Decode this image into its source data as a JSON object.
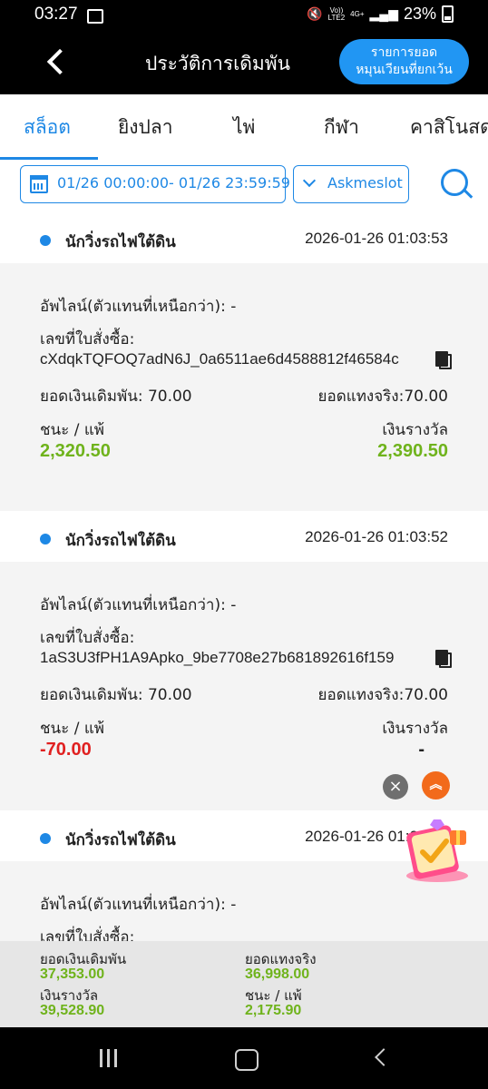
{
  "status_bar": {
    "time": "03:27",
    "network_top": "Vo))",
    "network_bottom": "LTE2",
    "data_top": "4G+",
    "battery": "23%"
  },
  "header": {
    "title": "ประวัติการเดิมพัน",
    "turnover_line1": "รายการยอด",
    "turnover_line2": "หมุนเวียนที่ยกเว้น"
  },
  "tabs": [
    {
      "label": "สล็อต",
      "active": true
    },
    {
      "label": "ยิงปลา",
      "active": false
    },
    {
      "label": "ไพ่",
      "active": false
    },
    {
      "label": "กีฬา",
      "active": false
    },
    {
      "label": "คาสิโนสด",
      "active": false
    }
  ],
  "filter": {
    "date_range": "01/26 00:00:00- 01/26 23:59:59",
    "game": "Askmeslot"
  },
  "records": [
    {
      "game": "นักวิ่งรถไฟใต้ดิน",
      "time": "2026-01-26 01:03:53",
      "upline": "อัพไลน์(ตัวแทนที่เหนือกว่า): -",
      "order_label": "เลขที่ใบสั่งซื้อ:",
      "order_id": "cXdqkTQFOQ7adN6J_0a6511ae6d4588812f46584c",
      "bet": "ยอดเงินเดิมพัน: 70.00",
      "actual": "ยอดแทงจริง:70.00",
      "winloss_label": "ชนะ / แพ้",
      "winloss": "2,320.50",
      "prize_label": "เงินรางวัล",
      "prize": "2,390.50"
    },
    {
      "game": "นักวิ่งรถไฟใต้ดิน",
      "time": "2026-01-26 01:03:52",
      "upline": "อัพไลน์(ตัวแทนที่เหนือกว่า): -",
      "order_label": "เลขที่ใบสั่งซื้อ:",
      "order_id": "1aS3U3fPH1A9Apko_9be7708e27b681892616f159",
      "bet": "ยอดเงินเดิมพัน: 70.00",
      "actual": "ยอดแทงจริง:70.00",
      "winloss_label": "ชนะ / แพ้",
      "winloss": "-70.00",
      "prize_label": "เงินรางวัล",
      "prize": "-"
    },
    {
      "game": "นักวิ่งรถไฟใต้ดิน",
      "time": "2026-01-26 01:03:52",
      "upline": "อัพไลน์(ตัวแทนที่เหนือกว่า): -",
      "order_label": "เลขที่ใบสั่งซื้อ:"
    }
  ],
  "summary": {
    "bet_label": "ยอดเงินเดิมพัน",
    "bet": "37,353.00",
    "actual_label": "ยอดแทงจริง",
    "actual": "36,998.00",
    "prize_label": "เงินรางวัล",
    "prize": "39,528.90",
    "winloss_label": "ชนะ / แพ้",
    "winloss": "2,175.90"
  },
  "floating": {
    "close_icon": "×",
    "up_icon": "︽"
  },
  "colors": {
    "accent": "#1e88e5",
    "win": "#6fb31c",
    "loss": "#e02020",
    "fab": "#f26a1b"
  }
}
